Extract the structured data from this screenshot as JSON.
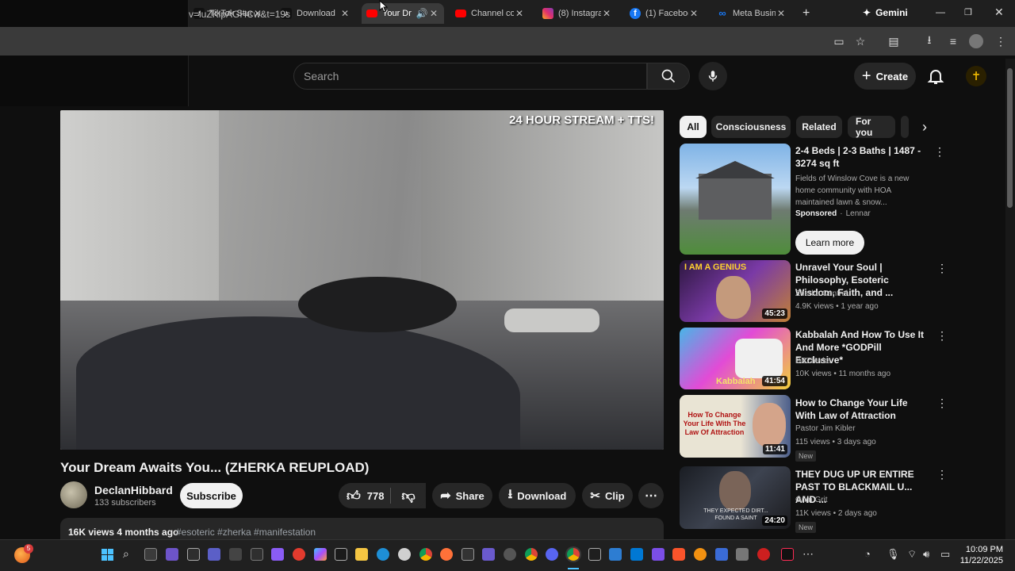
{
  "browser": {
    "tabs": [
      {
        "title": "TikTok Stud",
        "icon": "tiktok-icon",
        "active": false
      },
      {
        "title": "Download",
        "icon": "tiktok-icon",
        "active": false
      },
      {
        "title": "Your Dr",
        "icon": "youtube-icon",
        "active": true
      },
      {
        "title": "Channel co",
        "icon": "youtube-icon",
        "active": false
      },
      {
        "title": "(8) Instagra",
        "icon": "instagram-icon",
        "active": false
      },
      {
        "title": "(1) Faceboo",
        "icon": "facebook-icon",
        "active": false
      },
      {
        "title": "Meta Busin",
        "icon": "meta-icon",
        "active": false
      }
    ],
    "gemini_label": "Gemini",
    "url": "v=luZKlpAGHCw&t=19s"
  },
  "header": {
    "search_placeholder": "Search",
    "create_label": "Create"
  },
  "video": {
    "overlay_text": "24 HOUR STREAM + TTS!",
    "title": "Your Dream Awaits You... (ZHERKA REUPLOAD)",
    "channel_name": "DeclanHibbard",
    "subscribers": "133 subscribers",
    "subscribe_label": "Subscribe",
    "likes": "778",
    "share_label": "Share",
    "download_label": "Download",
    "clip_label": "Clip",
    "views_age": "16K views  4 months ago",
    "tags": "#esoteric #zherka #manifestation"
  },
  "chips": [
    "All",
    "Consciousness",
    "Related",
    "For you"
  ],
  "sidebar": {
    "ad": {
      "title": "2-4 Beds | 2-3 Baths | 1487 - 3274 sq ft",
      "desc": "Fields of Winslow Cove is a new home community with HOA maintained lawn & snow...",
      "sponsored": "Sponsored",
      "advertiser": "Lennar",
      "cta": "Learn more"
    },
    "videos": [
      {
        "title": "Unravel Your Soul | Philosophy, Esoteric Wisdom, Faith, and ...",
        "channel": "Zherka Central",
        "meta": "4.9K views • 1 year ago",
        "duration": "45:23",
        "thumb_text": "I AM A GENIUS",
        "badge": ""
      },
      {
        "title": "Kabbalah And How To Use It And More *GODPill Exclusive*",
        "channel": "DBZherka",
        "meta": "10K views • 11 months ago",
        "duration": "41:54",
        "thumb_text": "Kabbalah",
        "badge": ""
      },
      {
        "title": "How to Change Your Life With Law of Attraction",
        "channel": "Pastor Jim Kibler",
        "meta": "115 views • 3 days ago",
        "duration": "11:41",
        "thumb_text": "How To Change Your Life With The Law Of Attraction",
        "badge": "New"
      },
      {
        "title": "THEY DUG UP UR ENTIRE PAST TO BLACKMAIL U... AND ...",
        "channel": "Grim Grit",
        "meta": "11K views • 2 days ago",
        "duration": "24:20",
        "thumb_text": "THEY EXPECTED DIRT... FOUND A SAINT",
        "badge": "New"
      }
    ]
  },
  "taskbar": {
    "time": "10:09 PM",
    "date": "11/22/2025",
    "notification_count": "5"
  },
  "colors": {
    "yt_red": "#ff0000",
    "background": "#0f0f0f",
    "chip_bg": "#272727"
  }
}
